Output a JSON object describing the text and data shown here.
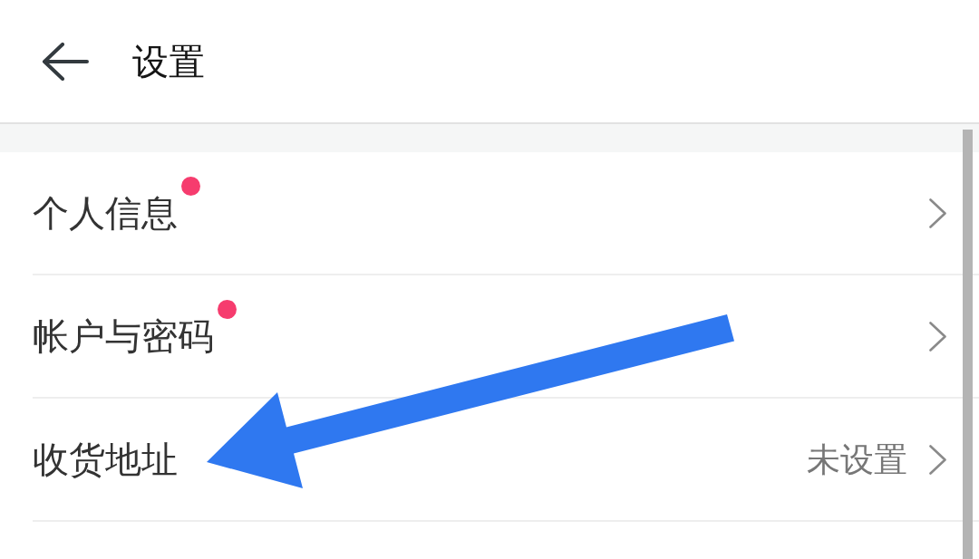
{
  "header": {
    "title": "设置"
  },
  "items": [
    {
      "label": "个人信息",
      "badge": true
    },
    {
      "label": "帐户与密码",
      "badge": true
    },
    {
      "label": "收货地址",
      "badge": false,
      "value": "未设置"
    }
  ]
}
